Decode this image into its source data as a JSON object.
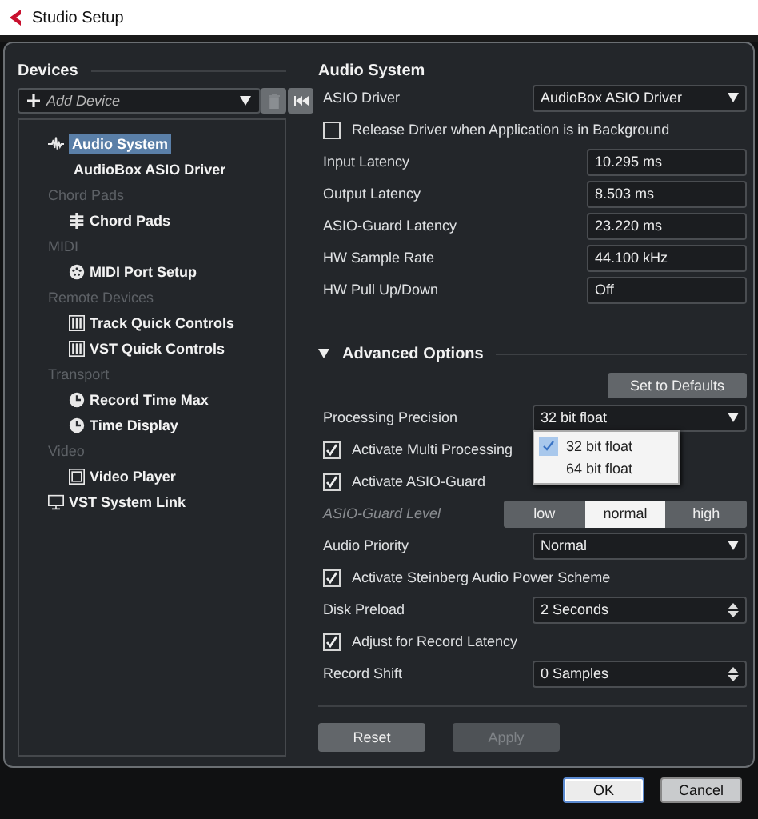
{
  "window": {
    "title": "Studio Setup"
  },
  "devices": {
    "title": "Devices",
    "add_device": {
      "placeholder": "Add Device"
    },
    "tree": [
      {
        "kind": "audio",
        "label": "Audio System",
        "selected": true,
        "children": [
          {
            "kind": "driver",
            "label": "AudioBox ASIO Driver",
            "selected": false
          }
        ]
      },
      {
        "kind": "category",
        "label": "Chord Pads",
        "children": [
          {
            "kind": "chord-pads",
            "label": "Chord Pads",
            "selected": false
          }
        ]
      },
      {
        "kind": "category",
        "label": "MIDI",
        "children": [
          {
            "kind": "midi",
            "label": "MIDI Port Setup",
            "selected": false
          }
        ]
      },
      {
        "kind": "category",
        "label": "Remote Devices",
        "children": [
          {
            "kind": "controls",
            "label": "Track Quick Controls",
            "selected": false
          },
          {
            "kind": "controls",
            "label": "VST Quick Controls",
            "selected": false
          }
        ]
      },
      {
        "kind": "category",
        "label": "Transport",
        "children": [
          {
            "kind": "clock",
            "label": "Record Time Max",
            "selected": false
          },
          {
            "kind": "clock",
            "label": "Time Display",
            "selected": false
          }
        ]
      },
      {
        "kind": "category",
        "label": "Video",
        "children": [
          {
            "kind": "video",
            "label": "Video Player",
            "selected": false
          }
        ]
      },
      {
        "kind": "monitor",
        "label": "VST System Link",
        "selected": false
      }
    ]
  },
  "audio_system": {
    "title": "Audio System",
    "rows": [
      {
        "kind": "dropdown",
        "label": "ASIO Driver",
        "value": "AudioBox ASIO Driver"
      },
      {
        "kind": "checkbox",
        "label": "Release Driver when Application is in Background",
        "checked": false
      },
      {
        "kind": "readout",
        "label": "Input Latency",
        "value": "10.295 ms"
      },
      {
        "kind": "readout",
        "label": "Output Latency",
        "value": "8.503 ms"
      },
      {
        "kind": "readout",
        "label": "ASIO-Guard Latency",
        "value": "23.220 ms"
      },
      {
        "kind": "readout",
        "label": "HW Sample Rate",
        "value": "44.100 kHz"
      },
      {
        "kind": "readout",
        "label": "HW Pull Up/Down",
        "value": "Off"
      }
    ]
  },
  "advanced": {
    "title": "Advanced Options",
    "expanded": true,
    "defaults_button": "Set to Defaults",
    "rows": [
      {
        "kind": "dropdown",
        "label": "Processing Precision",
        "value": "32 bit float",
        "menu": [
          {
            "label": "32 bit float",
            "selected": true
          },
          {
            "label": "64 bit float",
            "selected": false
          }
        ]
      },
      {
        "kind": "checkbox",
        "label": "Activate Multi Processing",
        "checked": true
      },
      {
        "kind": "checkbox",
        "label": "Activate ASIO-Guard",
        "checked": true
      },
      {
        "kind": "segmented",
        "label": "ASIO-Guard Level",
        "disabled": true,
        "options": [
          {
            "label": "low",
            "selected": false
          },
          {
            "label": "normal",
            "selected": true
          },
          {
            "label": "high",
            "selected": false
          }
        ]
      },
      {
        "kind": "dropdown",
        "label": "Audio Priority",
        "value": "Normal"
      },
      {
        "kind": "checkbox",
        "label": "Activate Steinberg Audio Power Scheme",
        "checked": true
      },
      {
        "kind": "spinbox",
        "label": "Disk Preload",
        "value": "2 Seconds"
      },
      {
        "kind": "checkbox",
        "label": "Adjust for Record Latency",
        "checked": true
      },
      {
        "kind": "spinbox",
        "label": "Record Shift",
        "value": "0 Samples"
      }
    ]
  },
  "panel_buttons": [
    {
      "label": "Reset",
      "disabled": false
    },
    {
      "label": "Apply",
      "disabled": true
    }
  ],
  "dialog_buttons": [
    {
      "label": "OK",
      "default": true
    },
    {
      "label": "Cancel",
      "default": false
    }
  ]
}
